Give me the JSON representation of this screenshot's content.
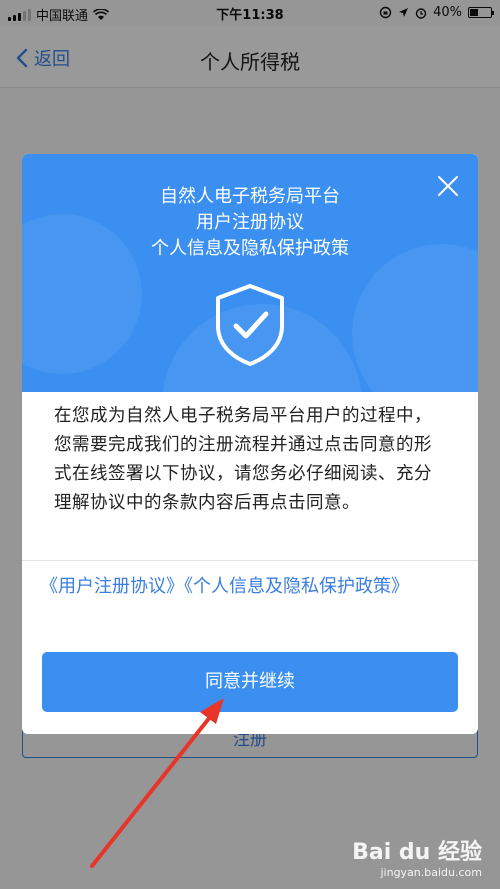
{
  "status_bar": {
    "carrier": "中国联通",
    "time": "下午11:38",
    "battery": "40%",
    "battery_level": 0.4
  },
  "nav": {
    "back_label": "返回",
    "title": "个人所得税"
  },
  "background": {
    "register_label": "注册"
  },
  "modal": {
    "title_line1": "自然人电子税务局平台",
    "title_line2": "用户注册协议",
    "title_line3": "个人信息及隐私保护政策",
    "body": "在您成为自然人电子税务局平台用户的过程中，您需要完成我们的注册流程并通过点击同意的形式在线签署以下协议，请您务必仔细阅读、充分理解协议中的条款内容后再点击同意。",
    "link_user_agreement": "《用户注册协议》",
    "link_privacy_policy": "《个人信息及隐私保护政策》",
    "agree_button": "同意并继续"
  },
  "watermark": {
    "main": "Bai du 经验",
    "sub": "jingyan.baidu.com"
  },
  "colors": {
    "accent": "#3a8ff0",
    "link": "#3a7ee0",
    "annotation_arrow": "#e8352a"
  },
  "icons": [
    "wifi-icon",
    "back-chevron-icon",
    "close-icon",
    "shield-check-icon",
    "lock-rotation-icon",
    "location-icon",
    "alarm-icon",
    "battery-icon"
  ]
}
